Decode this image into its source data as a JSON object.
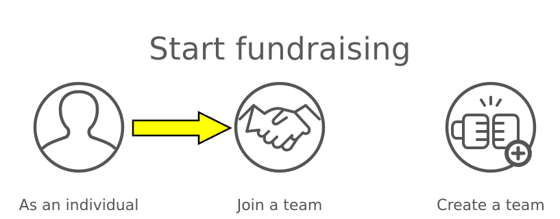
{
  "page": {
    "title": "Start fundraising"
  },
  "options": [
    {
      "label": "As an individual",
      "icon": "person-silhouette-icon"
    },
    {
      "label": "Join a team",
      "icon": "handshake-icon"
    },
    {
      "label": "Create a team",
      "icon": "fist-bump-plus-icon"
    }
  ],
  "annotation": {
    "type": "arrow",
    "color": "#ffff00",
    "outline": "#000000",
    "points_to": "Join a team"
  },
  "colors": {
    "text": "#555555",
    "icon_stroke": "#555555",
    "background": "#ffffff"
  }
}
